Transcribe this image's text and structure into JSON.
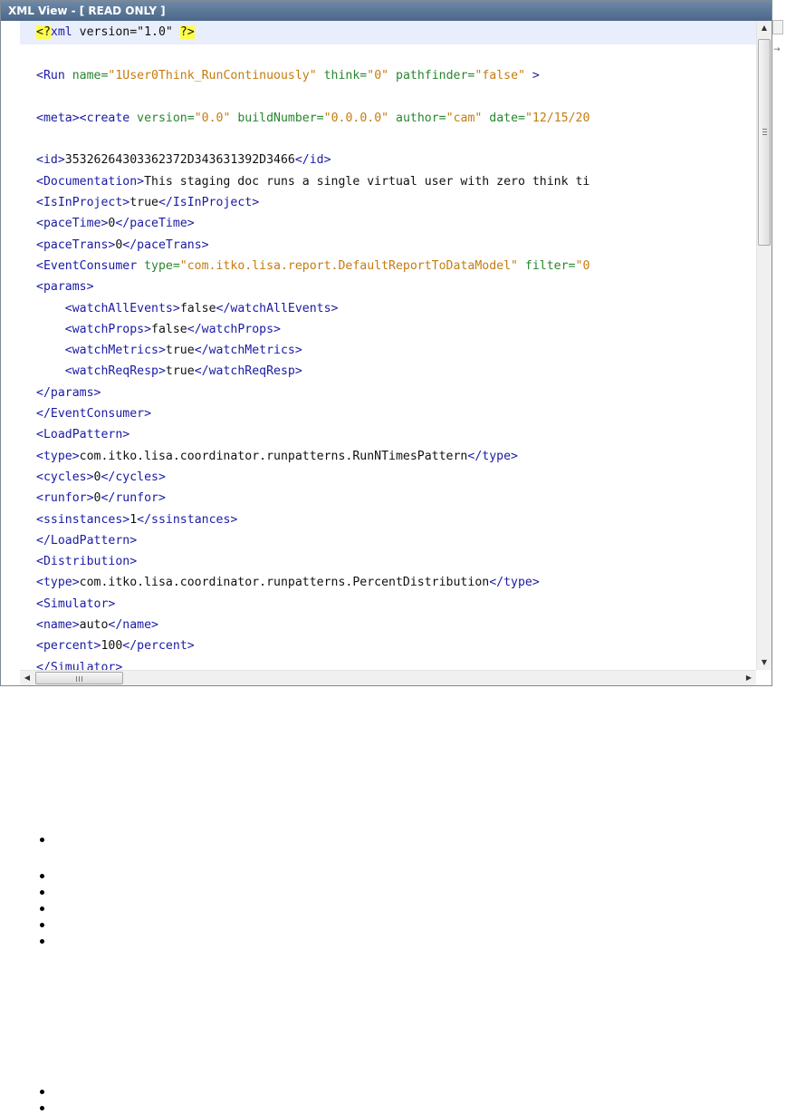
{
  "window": {
    "title": "XML View - [ READ ONLY ]"
  },
  "editor": {
    "lines": [
      [
        [
          "pi",
          "<?"
        ],
        [
          "tag",
          "xml"
        ],
        [
          "text",
          " version=\"1.0\" "
        ],
        [
          "pi",
          "?>"
        ]
      ],
      [],
      [
        [
          "tag",
          "<Run "
        ],
        [
          "attr",
          "name="
        ],
        [
          "val",
          "\"1User0Think_RunContinuously\""
        ],
        [
          "text",
          " "
        ],
        [
          "attr",
          "think="
        ],
        [
          "val",
          "\"0\""
        ],
        [
          "text",
          " "
        ],
        [
          "attr",
          "pathfinder="
        ],
        [
          "val",
          "\"false\""
        ],
        [
          "tag",
          " >"
        ]
      ],
      [],
      [
        [
          "tag",
          "<meta><create "
        ],
        [
          "attr",
          "version="
        ],
        [
          "val",
          "\"0.0\""
        ],
        [
          "text",
          " "
        ],
        [
          "attr",
          "buildNumber="
        ],
        [
          "val",
          "\"0.0.0.0\""
        ],
        [
          "text",
          " "
        ],
        [
          "attr",
          "author="
        ],
        [
          "val",
          "\"cam\""
        ],
        [
          "text",
          " "
        ],
        [
          "attr",
          "date="
        ],
        [
          "val",
          "\"12/15/20"
        ]
      ],
      [],
      [
        [
          "tag",
          "<id>"
        ],
        [
          "text",
          "35326264303362372D343631392D3466"
        ],
        [
          "tag",
          "</id>"
        ]
      ],
      [
        [
          "tag",
          "<Documentation>"
        ],
        [
          "text",
          "This staging doc runs a single virtual user with zero think ti"
        ]
      ],
      [
        [
          "tag",
          "<IsInProject>"
        ],
        [
          "text",
          "true"
        ],
        [
          "tag",
          "</IsInProject>"
        ]
      ],
      [
        [
          "tag",
          "<paceTime>"
        ],
        [
          "text",
          "0"
        ],
        [
          "tag",
          "</paceTime>"
        ]
      ],
      [
        [
          "tag",
          "<paceTrans>"
        ],
        [
          "text",
          "0"
        ],
        [
          "tag",
          "</paceTrans>"
        ]
      ],
      [
        [
          "tag",
          "<EventConsumer "
        ],
        [
          "attr",
          "type="
        ],
        [
          "val",
          "\"com.itko.lisa.report.DefaultReportToDataModel\""
        ],
        [
          "text",
          " "
        ],
        [
          "attr",
          "filter="
        ],
        [
          "val",
          "\"0"
        ]
      ],
      [
        [
          "tag",
          "<params>"
        ]
      ],
      [
        [
          "text",
          "    "
        ],
        [
          "tag",
          "<watchAllEvents>"
        ],
        [
          "text",
          "false"
        ],
        [
          "tag",
          "</watchAllEvents>"
        ]
      ],
      [
        [
          "text",
          "    "
        ],
        [
          "tag",
          "<watchProps>"
        ],
        [
          "text",
          "false"
        ],
        [
          "tag",
          "</watchProps>"
        ]
      ],
      [
        [
          "text",
          "    "
        ],
        [
          "tag",
          "<watchMetrics>"
        ],
        [
          "text",
          "true"
        ],
        [
          "tag",
          "</watchMetrics>"
        ]
      ],
      [
        [
          "text",
          "    "
        ],
        [
          "tag",
          "<watchReqResp>"
        ],
        [
          "text",
          "true"
        ],
        [
          "tag",
          "</watchReqResp>"
        ]
      ],
      [
        [
          "tag",
          "</params>"
        ]
      ],
      [
        [
          "tag",
          "</EventConsumer>"
        ]
      ],
      [
        [
          "tag",
          "<LoadPattern>"
        ]
      ],
      [
        [
          "tag",
          "<type>"
        ],
        [
          "text",
          "com.itko.lisa.coordinator.runpatterns.RunNTimesPattern"
        ],
        [
          "tag",
          "</type>"
        ]
      ],
      [
        [
          "tag",
          "<cycles>"
        ],
        [
          "text",
          "0"
        ],
        [
          "tag",
          "</cycles>"
        ]
      ],
      [
        [
          "tag",
          "<runfor>"
        ],
        [
          "text",
          "0"
        ],
        [
          "tag",
          "</runfor>"
        ]
      ],
      [
        [
          "tag",
          "<ssinstances>"
        ],
        [
          "text",
          "1"
        ],
        [
          "tag",
          "</ssinstances>"
        ]
      ],
      [
        [
          "tag",
          "</LoadPattern>"
        ]
      ],
      [
        [
          "tag",
          "<Distribution>"
        ]
      ],
      [
        [
          "tag",
          "<type>"
        ],
        [
          "text",
          "com.itko.lisa.coordinator.runpatterns.PercentDistribution"
        ],
        [
          "tag",
          "</type>"
        ]
      ],
      [
        [
          "tag",
          "<Simulator>"
        ]
      ],
      [
        [
          "tag",
          "<name>"
        ],
        [
          "text",
          "auto"
        ],
        [
          "tag",
          "</name>"
        ]
      ],
      [
        [
          "tag",
          "<percent>"
        ],
        [
          "text",
          "100"
        ],
        [
          "tag",
          "</percent>"
        ]
      ],
      [
        [
          "tag",
          "</Simulator>"
        ]
      ]
    ]
  },
  "scrollbars": {
    "up_arrow": "▲",
    "down_arrow": "▼",
    "left_arrow": "◀",
    "right_arrow": "▶",
    "vertical_position": 0.0,
    "horizontal_position": 0.0
  },
  "side_glyph": "→",
  "bullet_count": 8,
  "colors": {
    "tag": "#1a1aa6",
    "attr": "#27862e",
    "value": "#c47c10",
    "text": "#111111",
    "pi_highlight": "#ffff4a",
    "title_bar": "#5a7596"
  }
}
